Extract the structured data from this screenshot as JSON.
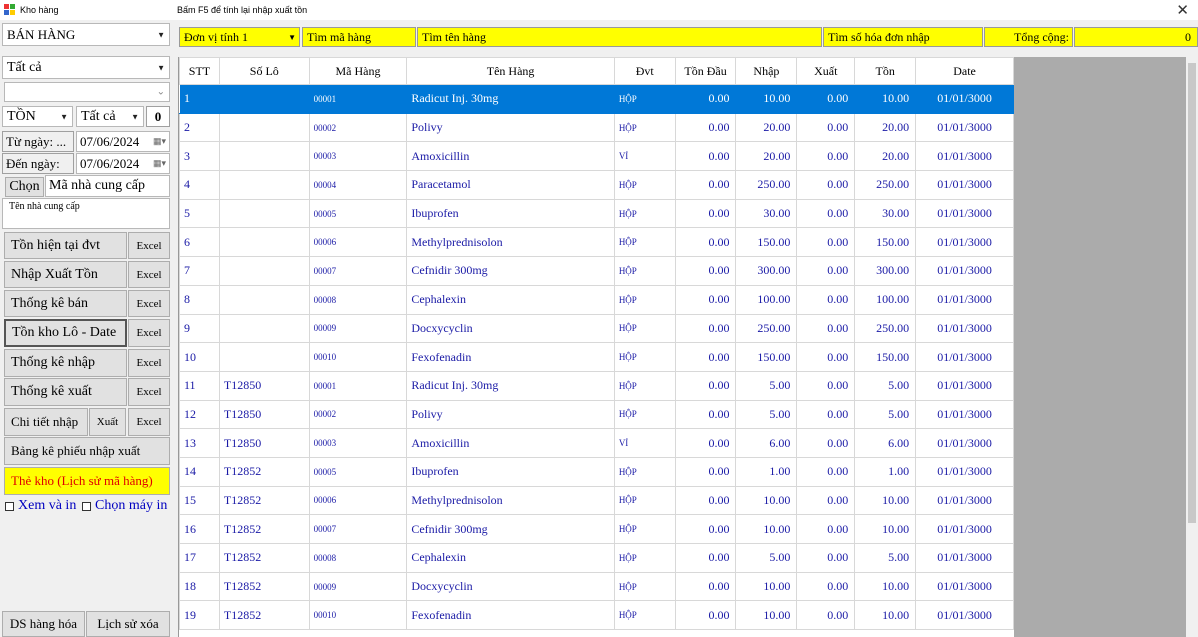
{
  "window": {
    "title": "Kho hàng",
    "hint": "Bấm F5 để tính lại  nhập xuất tồn",
    "close_glyph": "✕"
  },
  "left": {
    "store_select": "BÁN HÀNG",
    "group_select": "Tất cả",
    "sub_select": "",
    "stock_mode": "TỒN",
    "stock_filter": "Tất cả",
    "stock_count": "0",
    "from_label": "Từ ngày: ...",
    "from_date": "07/06/2024",
    "to_label": "Đến ngày:",
    "to_date": "07/06/2024",
    "choose_label": "Chọn",
    "supplier_code_placeholder": "Mã nhà cung cấp",
    "supplier_name_placeholder": "Tên nhà cung cấp",
    "reports": [
      {
        "label": "Tồn hiện tại đvt",
        "excel": "Excel"
      },
      {
        "label": "Nhập Xuất Tồn",
        "excel": "Excel"
      },
      {
        "label": "Thống kê bán",
        "excel": "Excel"
      },
      {
        "label": "Tồn kho Lô - Date",
        "excel": "Excel"
      },
      {
        "label": "Thống kê nhập",
        "excel": "Excel"
      },
      {
        "label": "Thống kê xuất",
        "excel": "Excel"
      }
    ],
    "detail_import": "Chi tiết nhập",
    "detail_export": "Xuất",
    "detail_excel": "Excel",
    "voucher_list": "Bảng kê phiếu nhập xuất",
    "stock_card": "Thẻ kho (Lịch sử mã hàng)",
    "view_print": "Xem và in",
    "choose_printer": "Chọn máy in",
    "goods_list": "DS hàng hóa",
    "delete_history": "Lịch sử xóa"
  },
  "topbar": {
    "unit_select": "Đơn vị tính 1",
    "search_code": "Tìm mã hàng",
    "search_name": "Tìm tên hàng",
    "search_invoice": "Tìm số hóa đơn nhập",
    "total_label": "Tổng cộng:",
    "total_value": "0"
  },
  "columns": [
    "STT",
    "Số Lô",
    "Mã Hàng",
    "Tên Hàng",
    "Đvt",
    "Tồn Đầu",
    "Nhập",
    "Xuất",
    "Tồn",
    "Date"
  ],
  "rows": [
    [
      "1",
      "",
      "00001",
      "Radicut Inj. 30mg",
      "HỘP",
      "0.00",
      "10.00",
      "0.00",
      "10.00",
      "01/01/3000"
    ],
    [
      "2",
      "",
      "00002",
      "Polivy",
      "HỘP",
      "0.00",
      "20.00",
      "0.00",
      "20.00",
      "01/01/3000"
    ],
    [
      "3",
      "",
      "00003",
      "Amoxicillin",
      "VỈ",
      "0.00",
      "20.00",
      "0.00",
      "20.00",
      "01/01/3000"
    ],
    [
      "4",
      "",
      "00004",
      "Paracetamol",
      "HỘP",
      "0.00",
      "250.00",
      "0.00",
      "250.00",
      "01/01/3000"
    ],
    [
      "5",
      "",
      "00005",
      "Ibuprofen",
      "HỘP",
      "0.00",
      "30.00",
      "0.00",
      "30.00",
      "01/01/3000"
    ],
    [
      "6",
      "",
      "00006",
      "Methylprednisolon",
      "HỘP",
      "0.00",
      "150.00",
      "0.00",
      "150.00",
      "01/01/3000"
    ],
    [
      "7",
      "",
      "00007",
      "Cefnidir 300mg",
      "HỘP",
      "0.00",
      "300.00",
      "0.00",
      "300.00",
      "01/01/3000"
    ],
    [
      "8",
      "",
      "00008",
      "Cephalexin",
      "HỘP",
      "0.00",
      "100.00",
      "0.00",
      "100.00",
      "01/01/3000"
    ],
    [
      "9",
      "",
      "00009",
      "Docxycyclin",
      "HỘP",
      "0.00",
      "250.00",
      "0.00",
      "250.00",
      "01/01/3000"
    ],
    [
      "10",
      "",
      "00010",
      "Fexofenadin",
      "HỘP",
      "0.00",
      "150.00",
      "0.00",
      "150.00",
      "01/01/3000"
    ],
    [
      "11",
      "T12850",
      "00001",
      "Radicut Inj. 30mg",
      "HỘP",
      "0.00",
      "5.00",
      "0.00",
      "5.00",
      "01/01/3000"
    ],
    [
      "12",
      "T12850",
      "00002",
      "Polivy",
      "HỘP",
      "0.00",
      "5.00",
      "0.00",
      "5.00",
      "01/01/3000"
    ],
    [
      "13",
      "T12850",
      "00003",
      "Amoxicillin",
      "VỈ",
      "0.00",
      "6.00",
      "0.00",
      "6.00",
      "01/01/3000"
    ],
    [
      "14",
      "T12852",
      "00005",
      "Ibuprofen",
      "HỘP",
      "0.00",
      "1.00",
      "0.00",
      "1.00",
      "01/01/3000"
    ],
    [
      "15",
      "T12852",
      "00006",
      "Methylprednisolon",
      "HỘP",
      "0.00",
      "10.00",
      "0.00",
      "10.00",
      "01/01/3000"
    ],
    [
      "16",
      "T12852",
      "00007",
      "Cefnidir 300mg",
      "HỘP",
      "0.00",
      "10.00",
      "0.00",
      "10.00",
      "01/01/3000"
    ],
    [
      "17",
      "T12852",
      "00008",
      "Cephalexin",
      "HỘP",
      "0.00",
      "5.00",
      "0.00",
      "5.00",
      "01/01/3000"
    ],
    [
      "18",
      "T12852",
      "00009",
      "Docxycyclin",
      "HỘP",
      "0.00",
      "10.00",
      "0.00",
      "10.00",
      "01/01/3000"
    ],
    [
      "19",
      "T12852",
      "00010",
      "Fexofenadin",
      "HỘP",
      "0.00",
      "10.00",
      "0.00",
      "10.00",
      "01/01/3000"
    ]
  ],
  "selected_row": 0,
  "colors": {
    "highlight": "#0078d7",
    "search_bar": "#ffff00",
    "cell_text": "#1a1aa6",
    "stock_card_text": "#e00000"
  }
}
